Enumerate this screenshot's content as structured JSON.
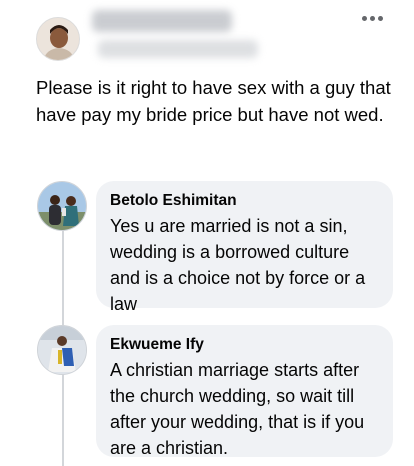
{
  "post": {
    "text": "Please is it right to have sex with a guy that have pay my bride price but have not wed."
  },
  "comments": [
    {
      "author": "Betolo Eshimitan",
      "text": "Yes u are married is not a sin, wedding is a borrowed culture and is a choice not by force or a law"
    },
    {
      "author": "Ekwueme Ify",
      "text": "A christian marriage starts after the church wedding, so wait till after your wedding, that is if you are a christian."
    }
  ],
  "colors": {
    "bubble": "#f0f2f5",
    "text": "#050505",
    "secondary": "#65676b",
    "thread_line": "#d3d6da"
  },
  "icons": {
    "more": "more-horizontal-icon"
  }
}
